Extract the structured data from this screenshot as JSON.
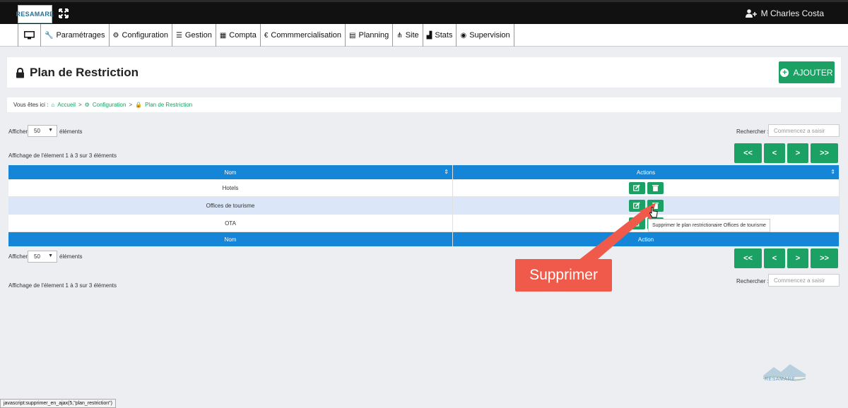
{
  "app": {
    "logo_text": "RESAMARE",
    "user_name": "M Charles Costa"
  },
  "menu": [
    {
      "icon": "monitor-icon",
      "label": ""
    },
    {
      "icon": "wrench-icon",
      "label": "Paramétrages"
    },
    {
      "icon": "cogs-icon",
      "label": "Configuration"
    },
    {
      "icon": "list-icon",
      "label": "Gestion"
    },
    {
      "icon": "calculator-icon",
      "label": "Compta"
    },
    {
      "icon": "euro-icon",
      "label": "Commmercialisation"
    },
    {
      "icon": "calendar-icon",
      "label": "Planning"
    },
    {
      "icon": "sitemap-icon",
      "label": "Site"
    },
    {
      "icon": "chart-icon",
      "label": "Stats"
    },
    {
      "icon": "eye-icon",
      "label": "Supervision"
    }
  ],
  "page": {
    "title": "Plan de Restriction",
    "add_label": "AJOUTER"
  },
  "breadcrumb": {
    "prefix": "Vous êtes ici :",
    "items": [
      "Accueil",
      "Configuration",
      "Plan de Restriction"
    ]
  },
  "controls": {
    "show_label": "Afficher",
    "page_size": "50",
    "elements_label": "éléments",
    "search_label": "Rechercher :",
    "search_placeholder": "Commencez a saisir",
    "info": "Affichage de l'élement 1 à 3 sur 3 éléments"
  },
  "pager": {
    "first": "<<",
    "prev": "<",
    "next": ">",
    "last": ">>"
  },
  "table": {
    "header": [
      "Nom",
      "Actions"
    ],
    "footer": [
      "Nom",
      "Action"
    ],
    "rows": [
      "Hotels",
      "Offices de tourisme",
      "OTA"
    ]
  },
  "tooltip": "Supprimer le plan restrictionaire Offices de tourisme",
  "annotation": "Supprimer",
  "watermark": "RESAMARE",
  "status_bar": "javascript:supprimer_en_ajax(5,\"plan_restriction\")",
  "colors": {
    "accent_green": "#1aa163",
    "table_header_blue": "#1585d8",
    "callout_red": "#f05a4a"
  }
}
